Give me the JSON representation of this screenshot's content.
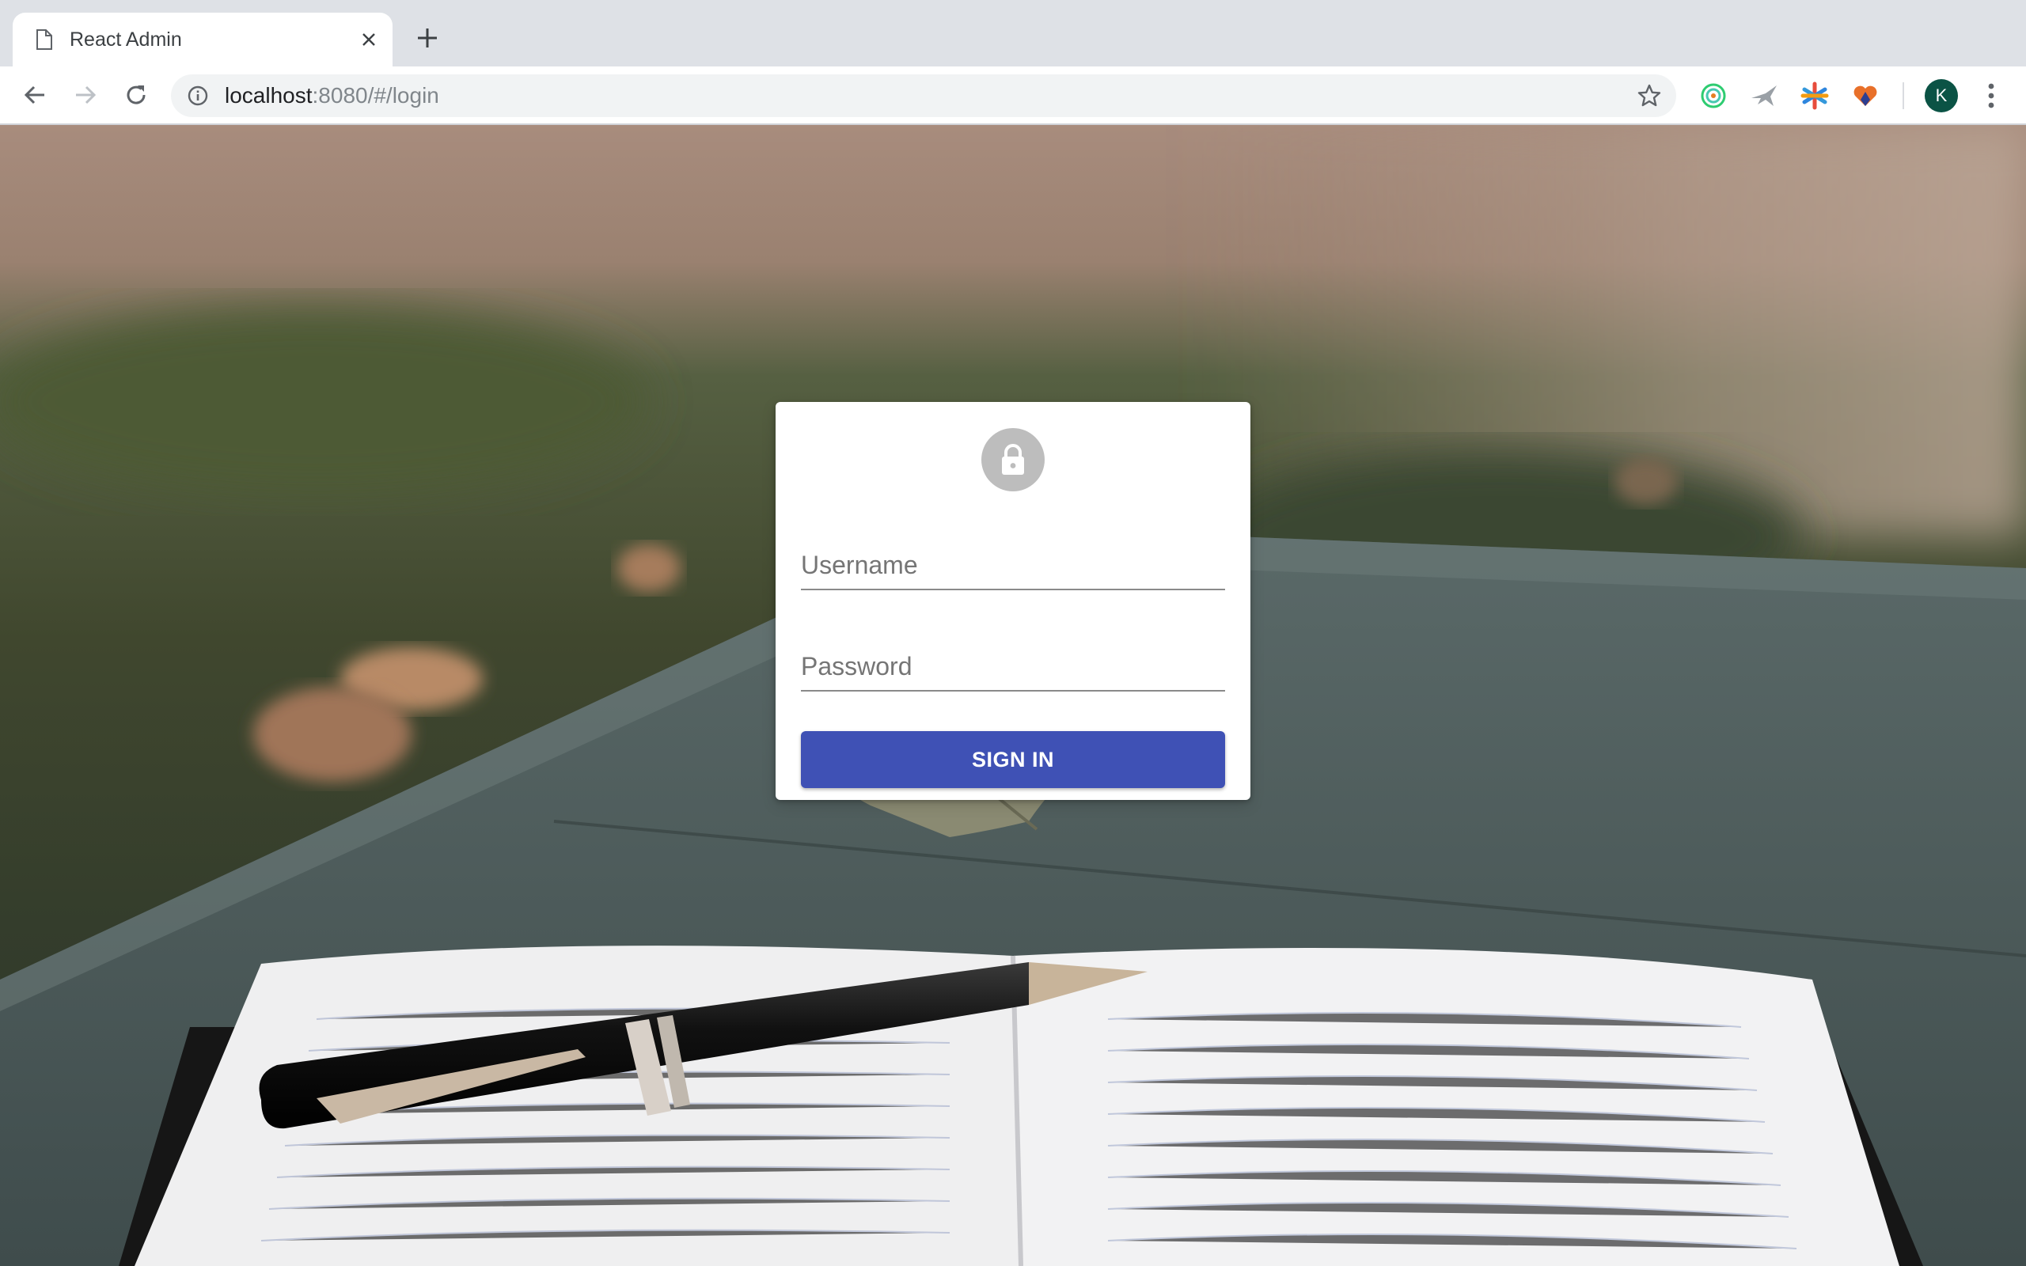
{
  "browser": {
    "tab": {
      "title": "React Admin",
      "favicon": "document-icon",
      "close": "close-icon"
    },
    "new_tab": "plus-icon",
    "url": {
      "host": "localhost",
      "rest": ":8080/#/login"
    },
    "profile_initial": "K",
    "extensions": [
      "circle-extension-icon",
      "bird-extension-icon",
      "asterisk-extension-icon",
      "heart-extension-icon"
    ]
  },
  "login": {
    "icon": "lock-icon",
    "username_placeholder": "Username",
    "password_placeholder": "Password",
    "signin_label": "SIGN IN"
  },
  "colors": {
    "primary": "#3f51b5",
    "avatar": "#bdbdbd",
    "profile": "#0b5345"
  }
}
